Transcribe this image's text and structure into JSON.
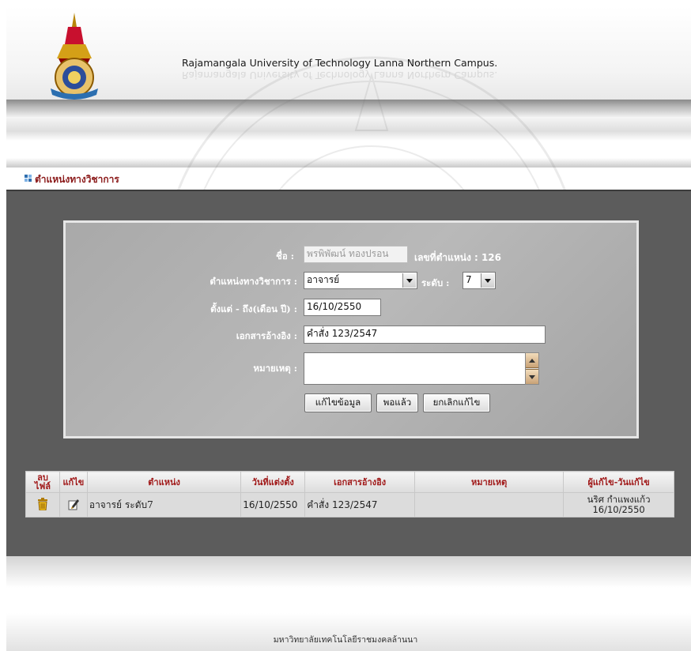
{
  "header": {
    "title": "Rajamangala University of Technology Lanna Northern Campus."
  },
  "section": {
    "title": "ตำแหน่งทางวิชาการ"
  },
  "form": {
    "name_label": "ชื่อ :",
    "name_value": "พรพิพัฒน์ ทองปรอน",
    "position_no_label": "เลขที่ตำแหน่ง : 126",
    "position_label": "ตำแหน่งทางวิชาการ :",
    "position_value": "อาจารย์",
    "level_label": "ระดับ :",
    "level_value": "7",
    "date_label": "ตั้งแต่ - ถึง(เดือน ปี) :",
    "date_value": "16/10/2550",
    "ref_label": "เอกสารอ้างอิง :",
    "ref_value": "คำสั่ง 123/2547",
    "note_label": "หมายเหตุ :",
    "note_value": "",
    "buttons": {
      "edit": "แก้ไขข้อมูล",
      "ok": "พอแล้ว",
      "cancel": "ยกเลิกแก้ไข"
    }
  },
  "table": {
    "headers": {
      "delete": "ลบ\nไฟล์",
      "edit": "แก้ไข",
      "position": "ตำแหน่ง",
      "appointed_date": "วันที่แต่งตั้ง",
      "reference": "เอกสารอ้างอิง",
      "note": "หมายเหตุ",
      "editor": "ผู้แก้ไข-วันแก้ไข"
    },
    "rows": [
      {
        "position": "อาจารย์ ระดับ7",
        "appointed_date": "16/10/2550",
        "reference": "คำสั่ง 123/2547",
        "note": "",
        "editor_name": "นริศ กำแพงแก้ว",
        "editor_date": "16/10/2550"
      }
    ]
  },
  "footer": {
    "text": "มหาวิทยาลัยเทคโนโลยีราชมงคลล้านนา"
  },
  "colors": {
    "section_title": "#8b1a1a",
    "table_header_text": "#a11a1a",
    "panel": "#5c5c5c"
  }
}
